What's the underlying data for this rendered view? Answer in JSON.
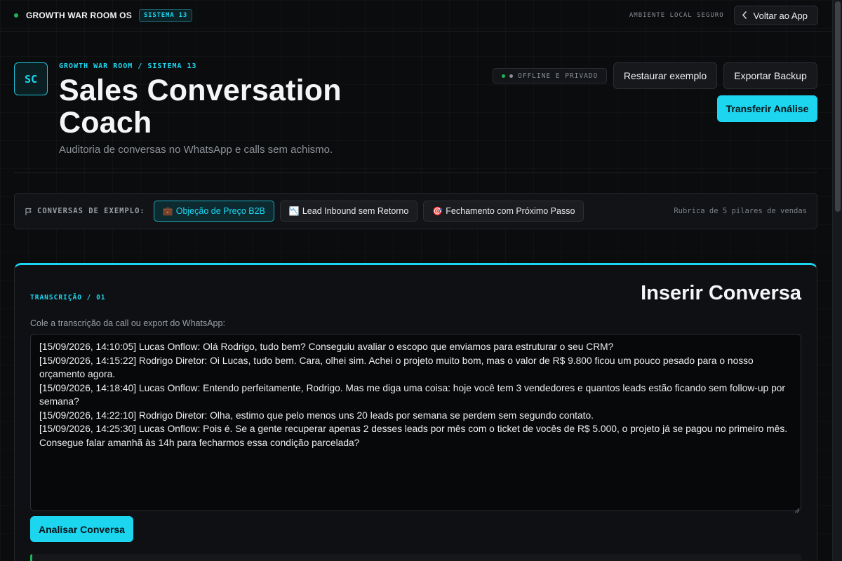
{
  "topbar": {
    "brand": "GROWTH WAR ROOM OS",
    "system_badge": "SISTEMA 13",
    "environment": "AMBIENTE LOCAL SEGURO",
    "back_label": "Voltar ao App"
  },
  "header": {
    "logo_text": "SC",
    "breadcrumb": "GROWTH WAR ROOM / SISTEMA 13",
    "title": "Sales Conversation Coach",
    "subtitle": "Auditoria de conversas no WhatsApp e calls sem achismo.",
    "status": "OFFLINE E PRIVADO",
    "restore_label": "Restaurar exemplo",
    "export_label": "Exportar Backup",
    "transfer_label": "Transferir Análise"
  },
  "examples": {
    "label": "CONVERSAS DE EXEMPLO:",
    "chips": [
      {
        "emoji": "💼",
        "label": "Objeção de Preço B2B",
        "active": true
      },
      {
        "emoji": "📉",
        "label": "Lead Inbound sem Retorno",
        "active": false
      },
      {
        "emoji": "🎯",
        "label": "Fechamento com Próximo Passo",
        "active": false
      }
    ],
    "rubric": "Rubrica de 5 pilares de vendas"
  },
  "card": {
    "tag": "TRANSCRIÇÃO / 01",
    "title": "Inserir Conversa",
    "field_label": "Cole a transcrição da call ou export do WhatsApp:",
    "transcript": "[15/09/2026, 14:10:05] Lucas Onflow: Olá Rodrigo, tudo bem? Conseguiu avaliar o escopo que enviamos para estruturar o seu CRM?\n[15/09/2026, 14:15:22] Rodrigo Diretor: Oi Lucas, tudo bem. Cara, olhei sim. Achei o projeto muito bom, mas o valor de R$ 9.800 ficou um pouco pesado para o nosso orçamento agora.\n[15/09/2026, 14:18:40] Lucas Onflow: Entendo perfeitamente, Rodrigo. Mas me diga uma coisa: hoje você tem 3 vendedores e quantos leads estão ficando sem follow-up por semana?\n[15/09/2026, 14:22:10] Rodrigo Diretor: Olha, estimo que pelo menos uns 20 leads por semana se perdem sem segundo contato.\n[15/09/2026, 14:25:30] Lucas Onflow: Pois é. Se a gente recuperar apenas 2 desses leads por mês com o ticket de vocês de R$ 5.000, o projeto já se pagou no primeiro mês. Consegue falar amanhã às 14h para fecharmos essa condição parcelada?",
    "analyze_label": "Analisar Conversa"
  },
  "colors": {
    "accent": "#1cd6f0",
    "status_green": "#1fb45a",
    "background": "#0b0c0e"
  }
}
